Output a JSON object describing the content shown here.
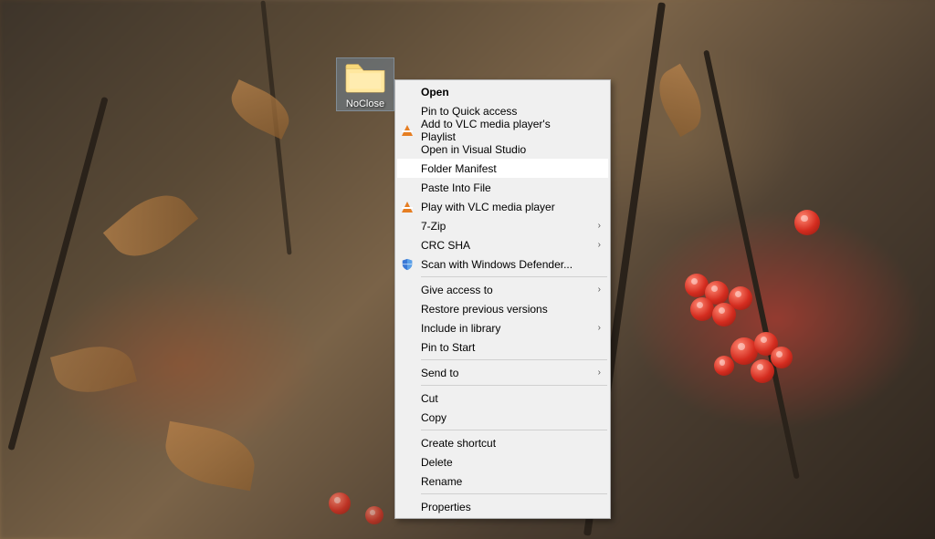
{
  "desktop": {
    "folder": {
      "label": "NoClose"
    }
  },
  "contextMenu": {
    "groups": [
      [
        {
          "key": "open",
          "label": "Open",
          "bold": true
        },
        {
          "key": "pin-quick-access",
          "label": "Pin to Quick access"
        },
        {
          "key": "vlc-add-playlist",
          "label": "Add to VLC media player's Playlist",
          "icon": "vlc"
        },
        {
          "key": "open-visual-studio",
          "label": "Open in Visual Studio"
        },
        {
          "key": "folder-manifest",
          "label": "Folder Manifest",
          "hovered": true
        },
        {
          "key": "paste-into-file",
          "label": "Paste Into File"
        },
        {
          "key": "vlc-play",
          "label": "Play with VLC media player",
          "icon": "vlc"
        },
        {
          "key": "seven-zip",
          "label": "7-Zip",
          "submenu": true
        },
        {
          "key": "crc-sha",
          "label": "CRC SHA",
          "submenu": true
        },
        {
          "key": "scan-defender",
          "label": "Scan with Windows Defender...",
          "icon": "shield"
        }
      ],
      [
        {
          "key": "give-access-to",
          "label": "Give access to",
          "submenu": true
        },
        {
          "key": "restore-previous",
          "label": "Restore previous versions"
        },
        {
          "key": "include-library",
          "label": "Include in library",
          "submenu": true
        },
        {
          "key": "pin-start",
          "label": "Pin to Start"
        }
      ],
      [
        {
          "key": "send-to",
          "label": "Send to",
          "submenu": true
        }
      ],
      [
        {
          "key": "cut",
          "label": "Cut"
        },
        {
          "key": "copy",
          "label": "Copy"
        }
      ],
      [
        {
          "key": "create-shortcut",
          "label": "Create shortcut"
        },
        {
          "key": "delete",
          "label": "Delete"
        },
        {
          "key": "rename",
          "label": "Rename"
        }
      ],
      [
        {
          "key": "properties",
          "label": "Properties"
        }
      ]
    ]
  }
}
